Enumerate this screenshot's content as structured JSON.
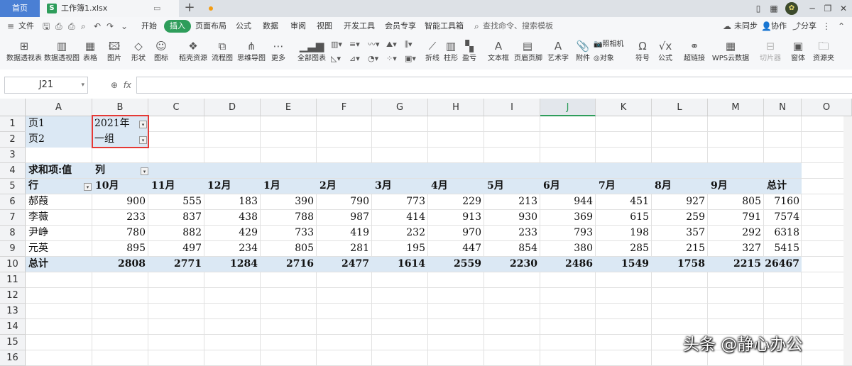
{
  "tabs": {
    "home": "首页",
    "file_name": "工作簿1.xlsx",
    "file_badge": "S"
  },
  "menu": {
    "file": "文件",
    "items": [
      "开始",
      "插入",
      "页面布局",
      "公式",
      "数据",
      "审阅",
      "视图",
      "开发工具",
      "会员专享",
      "智能工具箱"
    ],
    "active": "插入",
    "search": "查找命令、搜索模板",
    "sync": "未同步",
    "collab": "协作",
    "share": "分享"
  },
  "toolbar": {
    "pivot_table": "数据透视表",
    "pivot_view": "数据透视图",
    "table": "表格",
    "picture": "图片",
    "shape": "形状",
    "icon": "图标",
    "template_resource": "稻壳资源",
    "flowchart": "流程图",
    "mindmap": "思维导图",
    "more": "更多",
    "all_charts": "全部图表",
    "line": "折线",
    "column": "柱形",
    "win_loss": "盈亏",
    "textbox": "文本框",
    "header_footer": "页眉页脚",
    "art_text": "艺术字",
    "attachment": "附件",
    "camera": "照相机",
    "object": "对象",
    "symbol": "符号",
    "formula": "公式",
    "hyperlink": "超链接",
    "wps_cloud": "WPS云数据",
    "slicer": "切片器",
    "form": "窗体",
    "resource": "资源夹"
  },
  "formula_bar": {
    "name_box": "J21",
    "fx": "fx",
    "value": ""
  },
  "sheet": {
    "columns": [
      "A",
      "B",
      "C",
      "D",
      "E",
      "F",
      "G",
      "H",
      "I",
      "J",
      "K",
      "L",
      "M",
      "N",
      "O"
    ],
    "selected_column": "J",
    "rows": [
      "1",
      "2",
      "3",
      "4",
      "5",
      "6",
      "7",
      "8",
      "9",
      "10",
      "11",
      "12",
      "13",
      "14",
      "15",
      "16"
    ],
    "page_filters": [
      {
        "label": "页1",
        "value": "2021年"
      },
      {
        "label": "页2",
        "value": "一组"
      }
    ],
    "pivot": {
      "corner": "求和项:值",
      "col_label": "列",
      "row_label": "行",
      "months": [
        "10月",
        "11月",
        "12月",
        "1月",
        "2月",
        "3月",
        "4月",
        "5月",
        "6月",
        "7月",
        "8月",
        "9月"
      ],
      "total_label": "总计",
      "rows": [
        {
          "name": "郝葭",
          "values": [
            "900",
            "555",
            "183",
            "390",
            "790",
            "773",
            "229",
            "213",
            "944",
            "451",
            "927",
            "805"
          ],
          "total": "7160"
        },
        {
          "name": "李薇",
          "values": [
            "233",
            "837",
            "438",
            "788",
            "987",
            "414",
            "913",
            "930",
            "369",
            "615",
            "259",
            "791"
          ],
          "total": "7574"
        },
        {
          "name": "尹峥",
          "values": [
            "780",
            "882",
            "429",
            "733",
            "419",
            "232",
            "970",
            "233",
            "793",
            "198",
            "357",
            "292"
          ],
          "total": "6318"
        },
        {
          "name": "元英",
          "values": [
            "895",
            "497",
            "234",
            "805",
            "281",
            "195",
            "447",
            "854",
            "380",
            "285",
            "215",
            "327"
          ],
          "total": "5415"
        }
      ],
      "grand_totals": [
        "2808",
        "2771",
        "1284",
        "2716",
        "2477",
        "1614",
        "2559",
        "2230",
        "2486",
        "1549",
        "1758",
        "2215"
      ],
      "grand_total": "26467"
    }
  },
  "watermark": "头条 @静心办公",
  "colors": {
    "accent": "#2e9d5b",
    "home_tab": "#4a7fd4",
    "pivot_band": "#dbe8f4",
    "highlight_box": "#e53935"
  }
}
